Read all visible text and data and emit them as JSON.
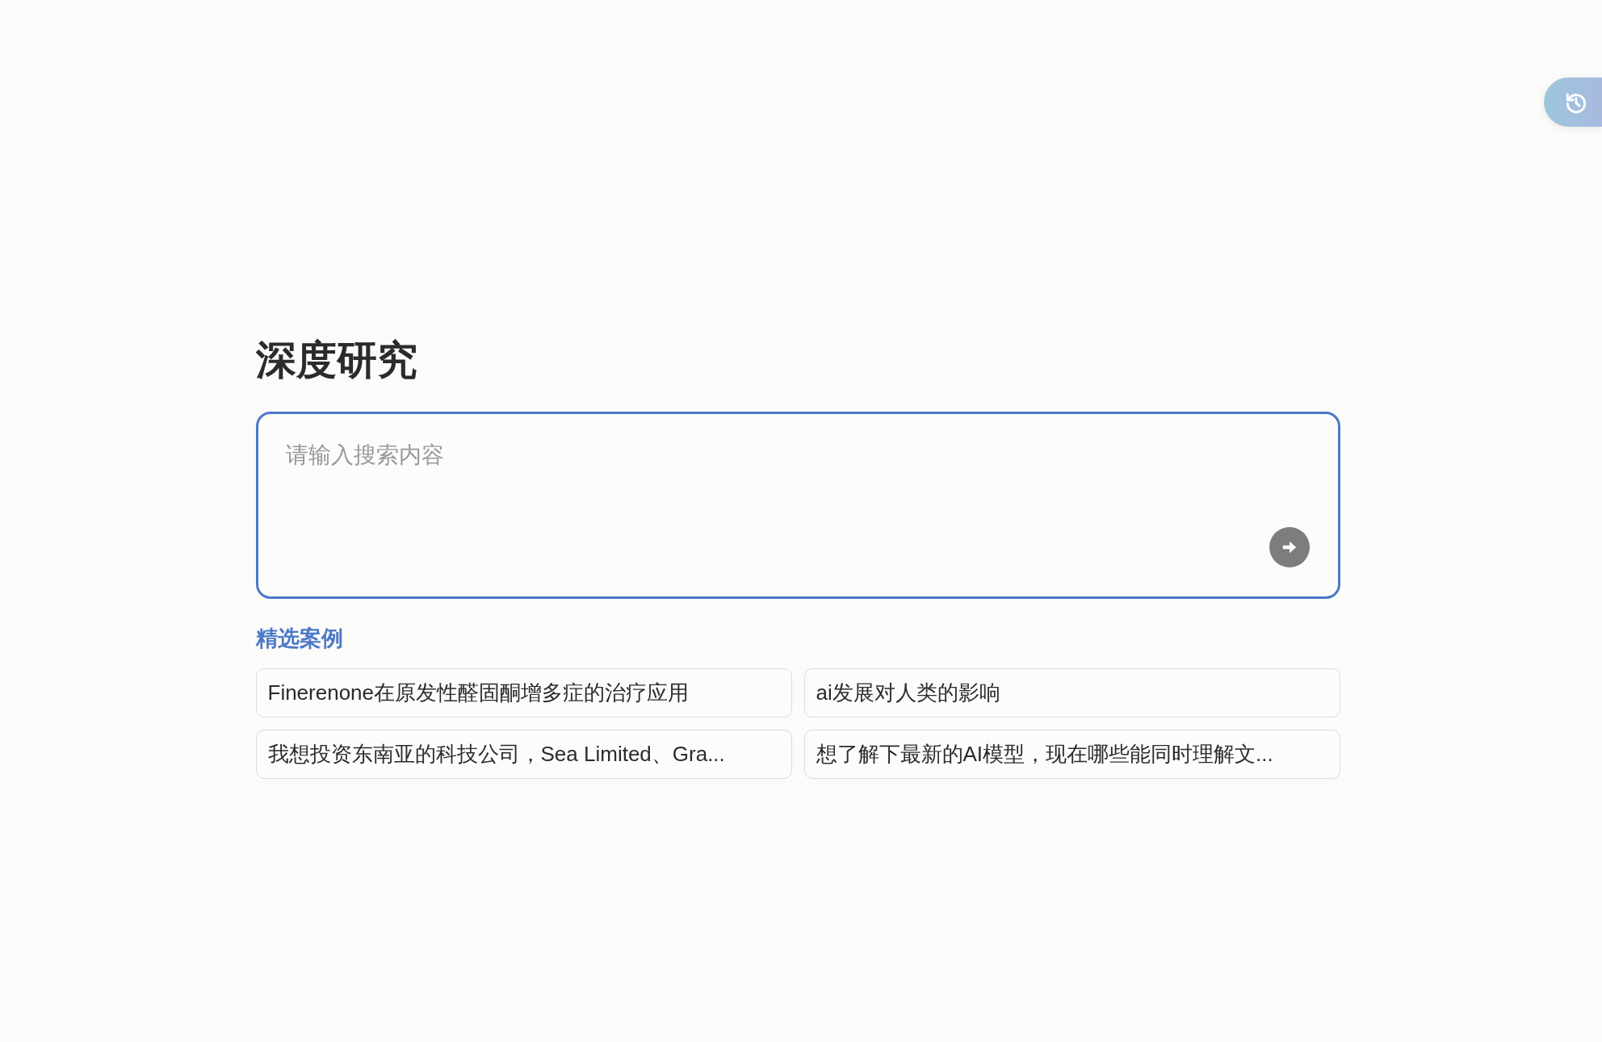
{
  "title": "深度研究",
  "search": {
    "placeholder": "请输入搜索内容"
  },
  "featured": {
    "heading": "精选案例",
    "cases": [
      {
        "text": "Finerenone在原发性醛固酮增多症的治疗应用"
      },
      {
        "text": "ai发展对人类的影响"
      },
      {
        "text": "我想投资东南亚的科技公司，Sea Limited、Gra..."
      },
      {
        "text": "想了解下最新的AI模型，现在哪些能同时理解文..."
      }
    ]
  }
}
